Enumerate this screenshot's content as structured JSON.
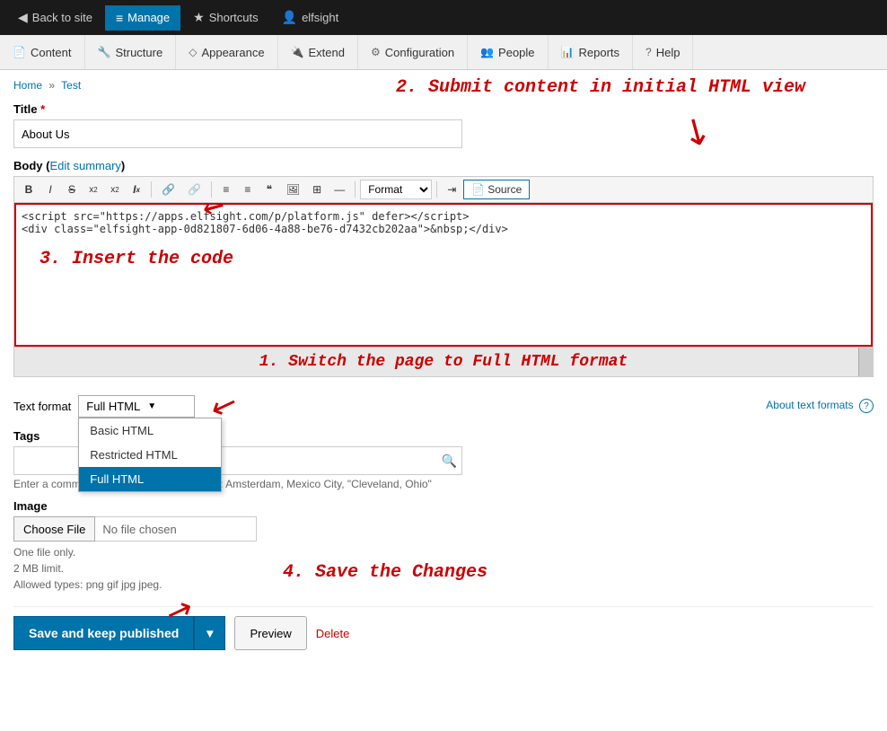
{
  "topNav": {
    "items": [
      {
        "id": "back-to-site",
        "label": "Back to site",
        "icon": "◀"
      },
      {
        "id": "manage",
        "label": "Manage",
        "icon": "≡"
      },
      {
        "id": "shortcuts",
        "label": "Shortcuts",
        "icon": "★"
      },
      {
        "id": "user",
        "label": "elfsight",
        "icon": "👤"
      }
    ]
  },
  "secondNav": {
    "items": [
      {
        "id": "content",
        "label": "Content",
        "icon": "📄"
      },
      {
        "id": "structure",
        "label": "Structure",
        "icon": "🔧"
      },
      {
        "id": "appearance",
        "label": "Appearance",
        "icon": "◇"
      },
      {
        "id": "extend",
        "label": "Extend",
        "icon": "🔌"
      },
      {
        "id": "configuration",
        "label": "Configuration",
        "icon": "⚙"
      },
      {
        "id": "people",
        "label": "People",
        "icon": "👥"
      },
      {
        "id": "reports",
        "label": "Reports",
        "icon": "📊"
      },
      {
        "id": "help",
        "label": "Help",
        "icon": "?"
      }
    ]
  },
  "breadcrumb": {
    "home": "Home",
    "separator": "»",
    "current": "Test"
  },
  "annotations": {
    "step2": "2. Submit content in initial HTML view",
    "step3": "3. Insert the code",
    "step1": "1. Switch the page to Full HTML format",
    "step4": "4. Save the Changes"
  },
  "form": {
    "titleLabel": "Title",
    "titleRequired": "*",
    "titleValue": "About Us",
    "bodyLabel": "Body",
    "editSummaryLink": "Edit summary",
    "editorCode": "<script src=\"https://apps.elfsight.com/p/platform.js\" defer></script>\n<div class=\"elfsight-app-0d821807-6d06-4a88-be76-d7432cb202aa\">&nbsp;</div>",
    "textFormatLabel": "Text format",
    "textFormatSelected": "Full HTML",
    "textFormatOptions": [
      "Basic HTML",
      "Restricted HTML",
      "Full HTML"
    ],
    "aboutFormatsLink": "About text formats",
    "tagsLabel": "Tags",
    "tagsPlaceholder": "",
    "tagsHint": "Enter a comma-separated list. For example: Amsterdam, Mexico City, \"Cleveland, Ohio\"",
    "imageLabel": "Image",
    "chooseFileBtn": "Choose File",
    "fileChosen": "No file chosen",
    "fileHint1": "One file only.",
    "fileHint2": "2 MB limit.",
    "fileHint3": "Allowed types: png gif jpg jpeg."
  },
  "toolbar": {
    "bold": "B",
    "italic": "I",
    "strikethrough": "S",
    "superscript": "x²",
    "subscript": "x₂",
    "removeFormat": "Ix",
    "link": "🔗",
    "unlink": "🔗",
    "bulletList": "≡",
    "numberedList": "≡",
    "blockquote": "❝",
    "image": "🖼",
    "table": "⊞",
    "hr": "—",
    "format": "Format",
    "source": "Source",
    "pageBreak": "⇥"
  },
  "saveSection": {
    "saveBtn": "Save and keep published",
    "previewBtn": "Preview",
    "deleteLink": "Delete"
  }
}
